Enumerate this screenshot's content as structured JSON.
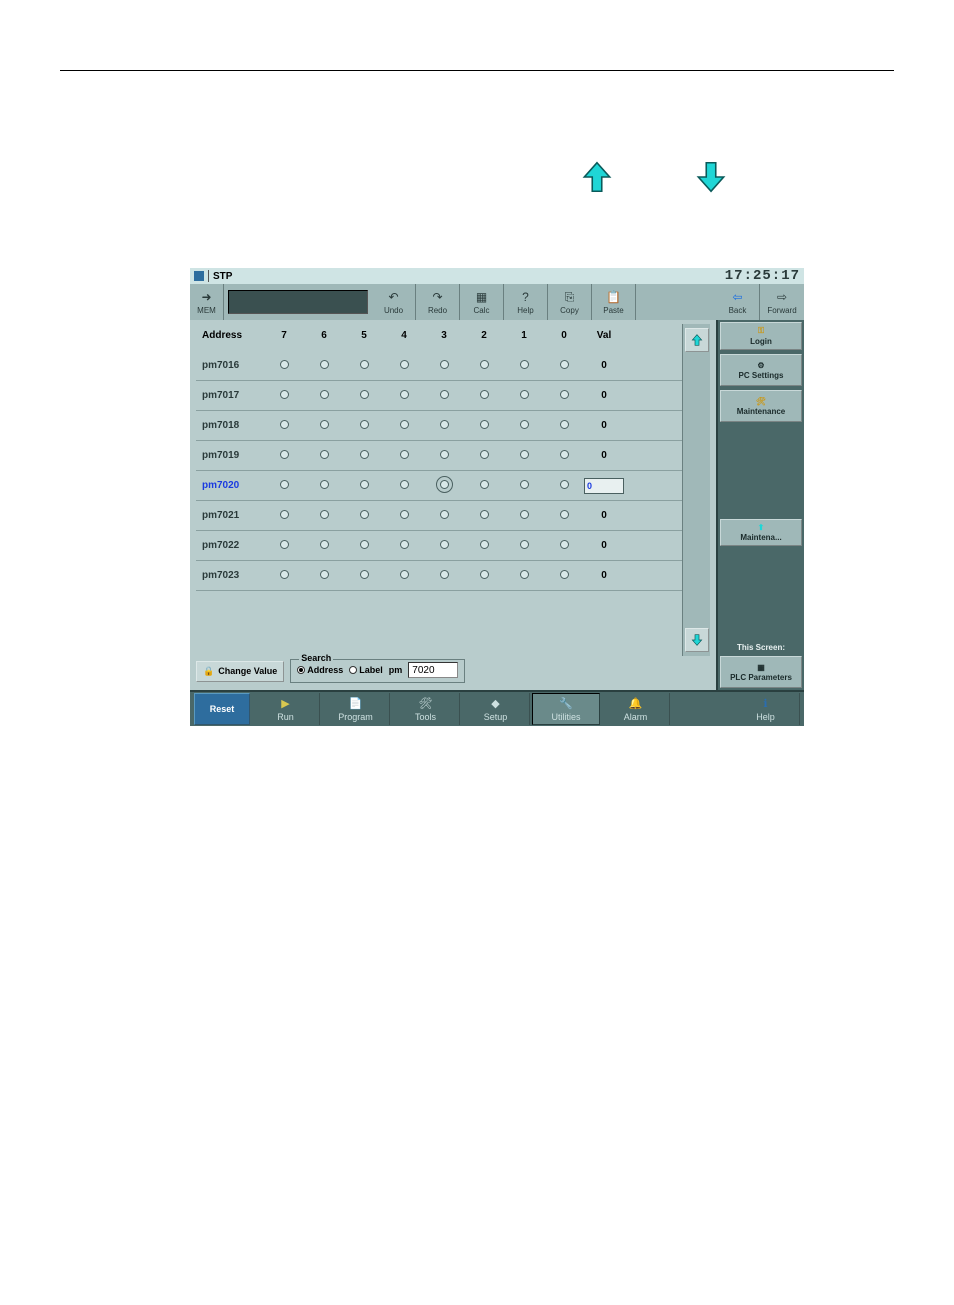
{
  "titlebar": {
    "status": "STP",
    "time": "17:25:17"
  },
  "toolbar": {
    "mem": "MEM",
    "undo": "Undo",
    "redo": "Redo",
    "calc": "Calc",
    "help": "Help",
    "copy": "Copy",
    "paste": "Paste",
    "back": "Back",
    "forward": "Forward"
  },
  "headers": [
    "Address",
    "7",
    "6",
    "5",
    "4",
    "3",
    "2",
    "1",
    "0",
    "Val"
  ],
  "rows": [
    {
      "addr": "pm7016",
      "bits": [
        0,
        0,
        0,
        0,
        0,
        0,
        0,
        0
      ],
      "val": "0",
      "selected": false
    },
    {
      "addr": "pm7017",
      "bits": [
        0,
        0,
        0,
        0,
        0,
        0,
        0,
        0
      ],
      "val": "0",
      "selected": false
    },
    {
      "addr": "pm7018",
      "bits": [
        0,
        0,
        0,
        0,
        0,
        0,
        0,
        0
      ],
      "val": "0",
      "selected": false
    },
    {
      "addr": "pm7019",
      "bits": [
        0,
        0,
        0,
        0,
        0,
        0,
        0,
        0
      ],
      "val": "0",
      "selected": false
    },
    {
      "addr": "pm7020",
      "bits": [
        0,
        0,
        0,
        0,
        0,
        0,
        0,
        0
      ],
      "val": "0",
      "selected": true
    },
    {
      "addr": "pm7021",
      "bits": [
        0,
        0,
        0,
        0,
        0,
        0,
        0,
        0
      ],
      "val": "0",
      "selected": false
    },
    {
      "addr": "pm7022",
      "bits": [
        0,
        0,
        0,
        0,
        0,
        0,
        0,
        0
      ],
      "val": "0",
      "selected": false
    },
    {
      "addr": "pm7023",
      "bits": [
        0,
        0,
        0,
        0,
        0,
        0,
        0,
        0
      ],
      "val": "0",
      "selected": false
    }
  ],
  "change_value": "Change Value",
  "search": {
    "legend": "Search",
    "address": "Address",
    "label": "Label",
    "prefix": "pm",
    "value": "7020"
  },
  "sidebar": {
    "login": "Login",
    "pcsettings": "PC Settings",
    "maintenance": "Maintenance",
    "maintena": "Maintena...",
    "this_screen": "This Screen:",
    "plc_parameters": "PLC Parameters"
  },
  "bottombar": {
    "reset": "Reset",
    "run": "Run",
    "program": "Program",
    "tools": "Tools",
    "setup": "Setup",
    "utilities": "Utilities",
    "alarm": "Alarm",
    "help": "Help"
  }
}
